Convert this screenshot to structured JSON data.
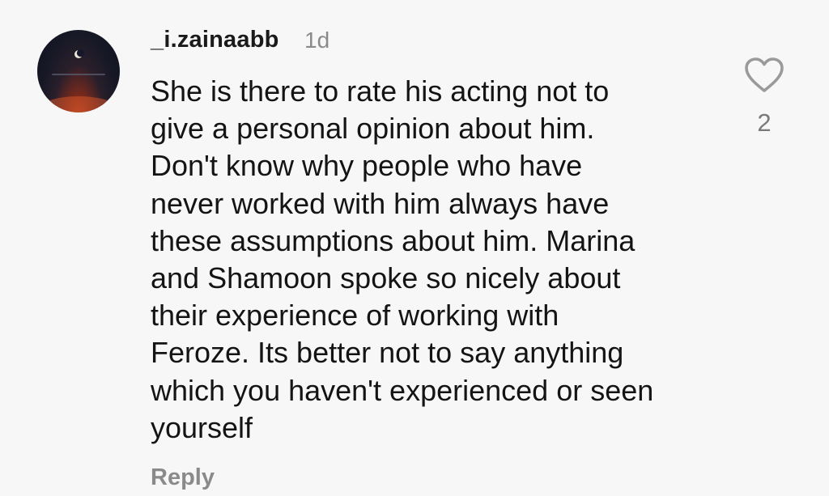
{
  "comment": {
    "username": "_i.zainaabb",
    "time": "1d",
    "text": "She is there to rate his acting not to\ngive a personal opinion about him.\nDon't know why people who have\nnever worked with him always have\nthese assumptions about him. Marina\nand Shamoon spoke so nicely about\ntheir experience of working with\nFeroze. Its better not to say anything\nwhich you haven't experienced or seen\nyourself",
    "like_icon": "heart-outline-icon",
    "like_count": "2",
    "reply_label": "Reply"
  },
  "colors": {
    "background": "#f7f7f7",
    "text": "#141414",
    "muted": "#8a8a8a",
    "icon": "#9a9a9a"
  }
}
